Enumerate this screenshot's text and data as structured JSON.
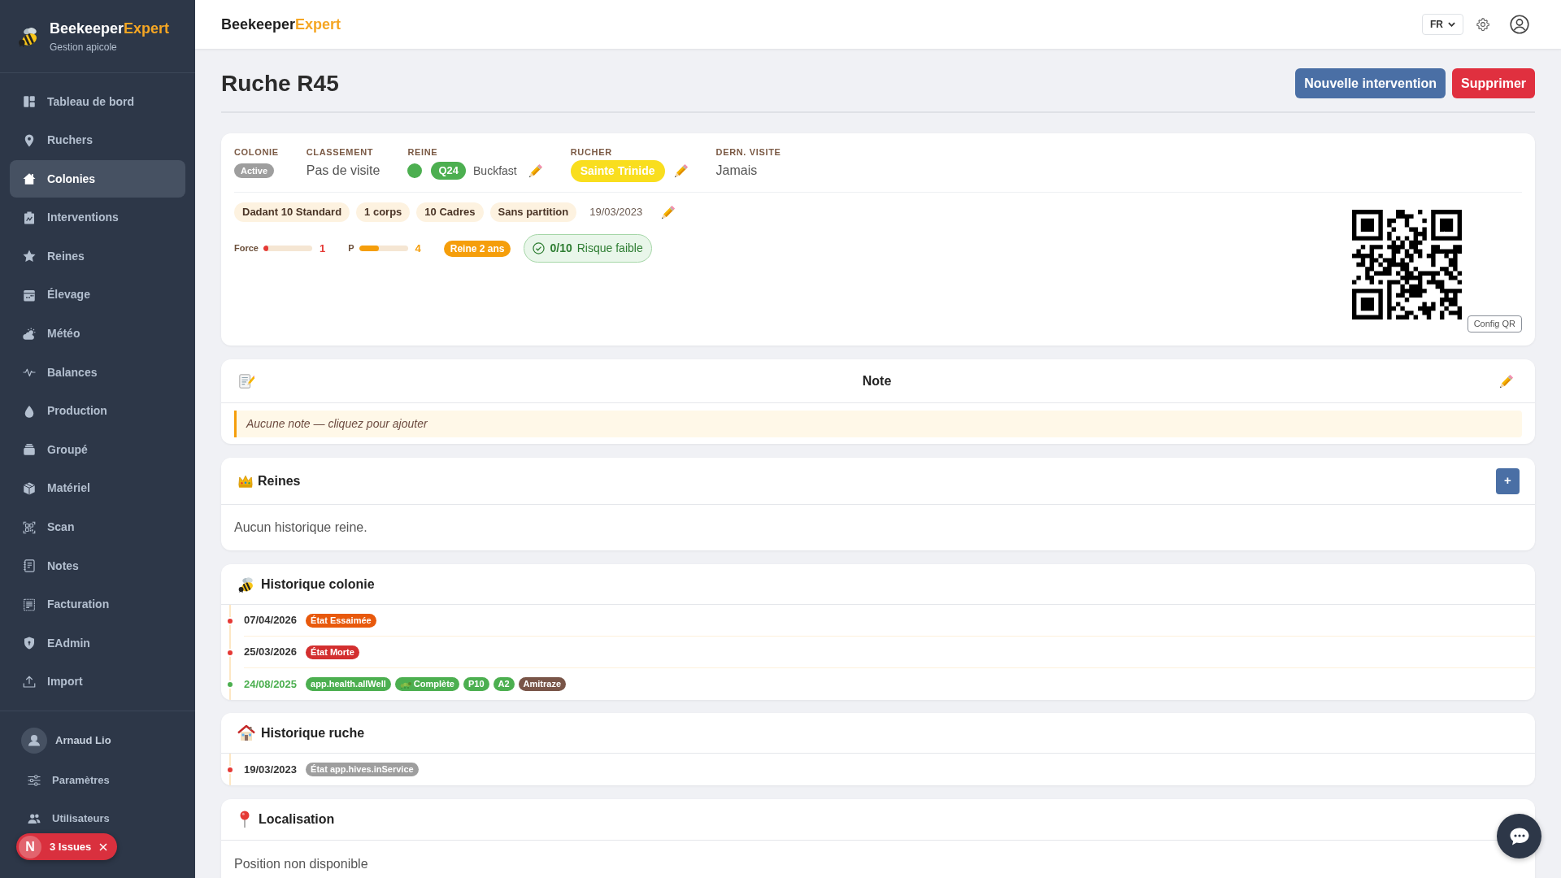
{
  "sidebar": {
    "brand": {
      "name": "Beekeeper",
      "accent": "Expert"
    },
    "subtitle": "Gestion apicole",
    "items": [
      {
        "label": "Tableau de bord",
        "selected": false
      },
      {
        "label": "Ruchers",
        "selected": false
      },
      {
        "label": "Colonies",
        "selected": true
      },
      {
        "label": "Interventions",
        "selected": false
      },
      {
        "label": "Reines",
        "selected": false
      },
      {
        "label": "Élevage",
        "selected": false
      },
      {
        "label": "Météo",
        "selected": false
      },
      {
        "label": "Balances",
        "selected": false
      },
      {
        "label": "Production",
        "selected": false
      },
      {
        "label": "Groupé",
        "selected": false
      },
      {
        "label": "Matériel",
        "selected": false
      },
      {
        "label": "Scan",
        "selected": false
      },
      {
        "label": "Notes",
        "selected": false
      },
      {
        "label": "Facturation",
        "selected": false
      },
      {
        "label": "EAdmin",
        "selected": false
      },
      {
        "label": "Import",
        "selected": false
      }
    ],
    "user": {
      "name": "Arnaud Lio"
    },
    "footer_items": [
      {
        "label": "Paramètres",
        "selected": false
      },
      {
        "label": "Utilisateurs",
        "selected": false
      }
    ]
  },
  "header": {
    "brand": {
      "name": "Beekeeper",
      "accent": "Expert"
    },
    "language": "FR"
  },
  "page": {
    "title": "Ruche R45",
    "actions": [
      {
        "label": "Nouvelle intervention",
        "kind": "primary"
      },
      {
        "label": "Supprimer",
        "kind": "danger"
      }
    ]
  },
  "summary": {
    "fields": [
      {
        "kind": "status",
        "label": "COLONIE",
        "value": "Active"
      },
      {
        "kind": "text",
        "label": "CLASSEMENT",
        "value": "Pas de visite"
      },
      {
        "kind": "queen",
        "label": "REINE",
        "color": "#4caf50",
        "code": "Q24",
        "breed": "Buckfast",
        "editable": true
      },
      {
        "kind": "apiary",
        "label": "RUCHER",
        "value": "Sainte Trinide",
        "editable": true
      },
      {
        "kind": "text",
        "label": "DERN. VISITE",
        "value": "Jamais"
      }
    ],
    "tags": [
      "Dadant 10 Standard",
      "1 corps",
      "10 Cadres",
      "Sans partition"
    ],
    "install_date": {
      "value": "19/03/2023",
      "editable": true
    },
    "metrics": [
      {
        "label": "Force",
        "level": 0.1,
        "reading": "1",
        "color": "#e53935"
      },
      {
        "label": "P",
        "level": 0.4,
        "reading": "4",
        "color": "#f59e0b"
      }
    ],
    "queen_age": "Reine 2 ans",
    "risk": {
      "score": "0/10",
      "label": "Risque faible"
    },
    "qr_button": "Config QR"
  },
  "note": {
    "title": "Note",
    "editable": true,
    "empty_text": "Aucune note — cliquez pour ajouter"
  },
  "queens": {
    "title": "Reines",
    "add_label": "+",
    "empty_text": "Aucun historique reine."
  },
  "colony_history": {
    "title": "Historique colonie",
    "entries": [
      {
        "date": "07/04/2026",
        "kind": "state",
        "badges": [
          {
            "text": "État Essaimée",
            "color": "#e8590c"
          }
        ]
      },
      {
        "date": "25/03/2026",
        "kind": "state",
        "badges": [
          {
            "text": "État Morte",
            "color": "#d32f2f"
          }
        ]
      },
      {
        "date": "24/08/2025",
        "kind": "visit",
        "badges": [
          {
            "text": "app.health.allWell",
            "color": "#4caf50"
          },
          {
            "text": "Complète",
            "color": "#4caf50",
            "icon": true
          },
          {
            "text": "P10",
            "color": "#4caf50"
          },
          {
            "text": "A2",
            "color": "#4caf50"
          },
          {
            "text": "Amitraze",
            "color": "#795548"
          }
        ]
      }
    ]
  },
  "hive_history": {
    "title": "Historique ruche",
    "entries": [
      {
        "date": "19/03/2023",
        "kind": "state",
        "badges": [
          {
            "text": "État app.hives.inService",
            "color": "#9e9e9e"
          }
        ]
      }
    ]
  },
  "location": {
    "title": "Localisation",
    "empty_text": "Position non disponible"
  },
  "dev_overlay": {
    "logo": "N",
    "label": "3 Issues"
  }
}
